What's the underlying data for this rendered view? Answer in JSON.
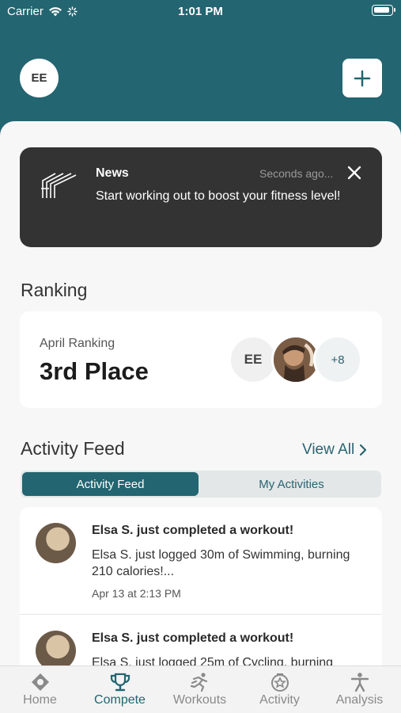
{
  "status_bar": {
    "carrier": "Carrier",
    "time": "1:01 PM"
  },
  "header": {
    "avatar_initials": "EE"
  },
  "news": {
    "title": "News",
    "time": "Seconds ago...",
    "message": "Start working out to boost your fitness level!"
  },
  "ranking": {
    "section_title": "Ranking",
    "label": "April Ranking",
    "place": "3rd Place",
    "avatar_initials": "EE",
    "more_count": "+8"
  },
  "activity": {
    "section_title": "Activity Feed",
    "view_all": "View All",
    "tabs": [
      "Activity Feed",
      "My Activities"
    ],
    "items": [
      {
        "title": "Elsa S. just completed a workout!",
        "body": "Elsa S. just logged 30m of Swimming, burning 210 calories!...",
        "date": "Apr 13 at 2:13 PM"
      },
      {
        "title": "Elsa S. just completed a workout!",
        "body": "Elsa S. just logged 25m of Cycling, burning",
        "date": ""
      }
    ]
  },
  "tabbar": {
    "items": [
      {
        "label": "Home",
        "icon": "home-icon"
      },
      {
        "label": "Compete",
        "icon": "trophy-icon"
      },
      {
        "label": "Workouts",
        "icon": "runner-icon"
      },
      {
        "label": "Activity",
        "icon": "activity-badge-icon"
      },
      {
        "label": "Analysis",
        "icon": "person-icon"
      }
    ],
    "active": "Compete"
  },
  "colors": {
    "brand": "#236570",
    "news_bg": "#333333"
  }
}
